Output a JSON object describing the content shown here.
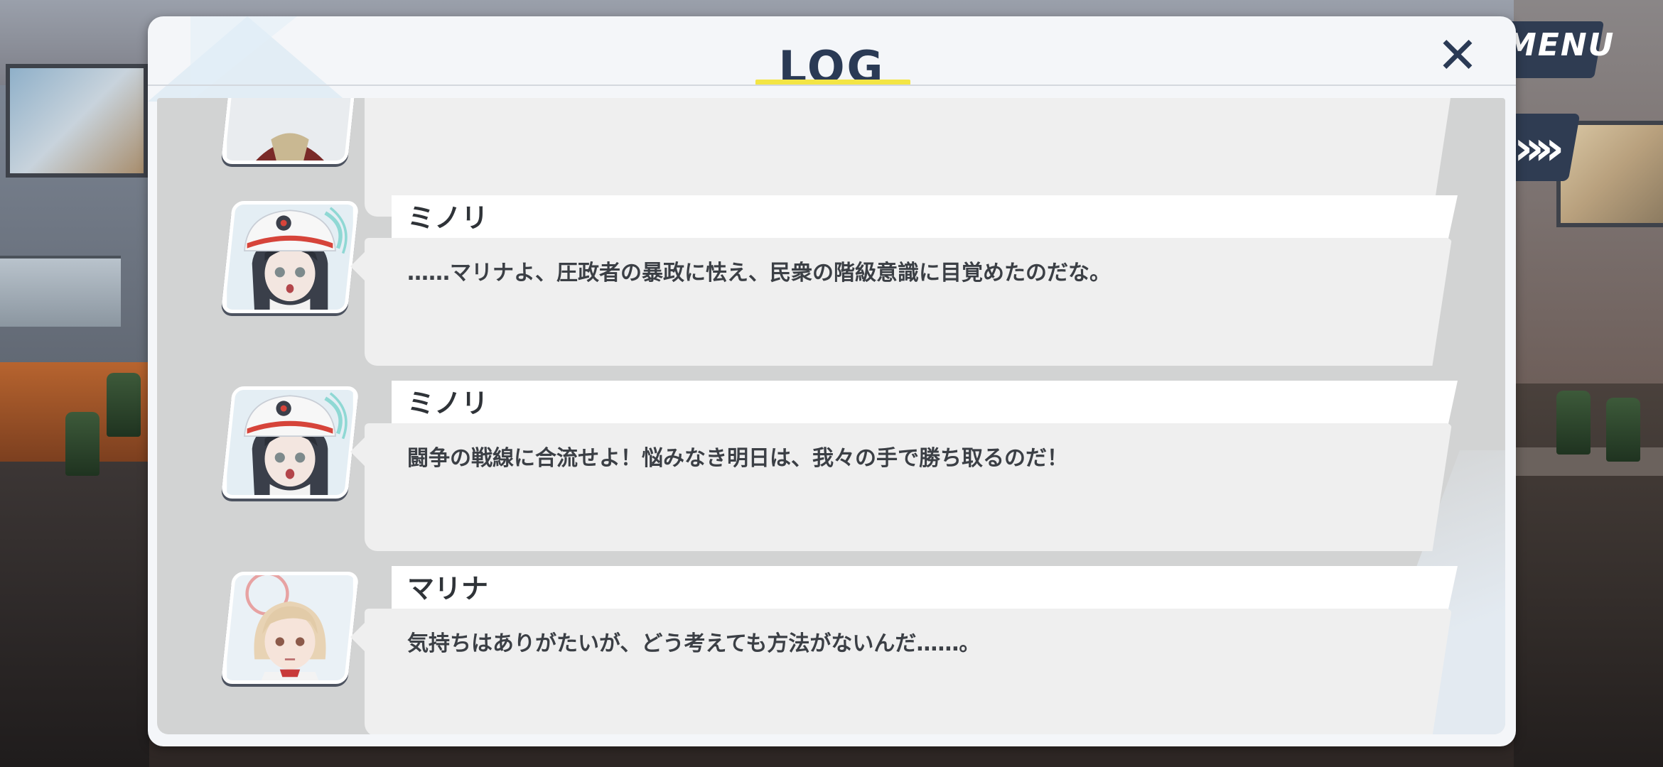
{
  "background": {
    "menu_label": "MENU",
    "skip_icon": "fast-forward-icon",
    "skip_glyph": "»»"
  },
  "log": {
    "title": "LOG",
    "close_glyph": "✕",
    "accent_color": "#f3e545",
    "title_color": "#2a3a55",
    "entries": [
      {
        "speaker": "ミノリ",
        "message": "……マリナよ、圧政者の暴政に怯え、民衆の階級意識に目覚めたのだな。",
        "avatar": "minori-avatar"
      },
      {
        "speaker": "ミノリ",
        "message": "闘争の戦線に合流せよ！悩みなき明日は、我々の手で勝ち取るのだ！",
        "avatar": "minori-avatar"
      },
      {
        "speaker": "マリナ",
        "message": "気持ちはありがたいが、どう考えても方法がないんだ……。",
        "avatar": "marina-avatar"
      }
    ]
  }
}
